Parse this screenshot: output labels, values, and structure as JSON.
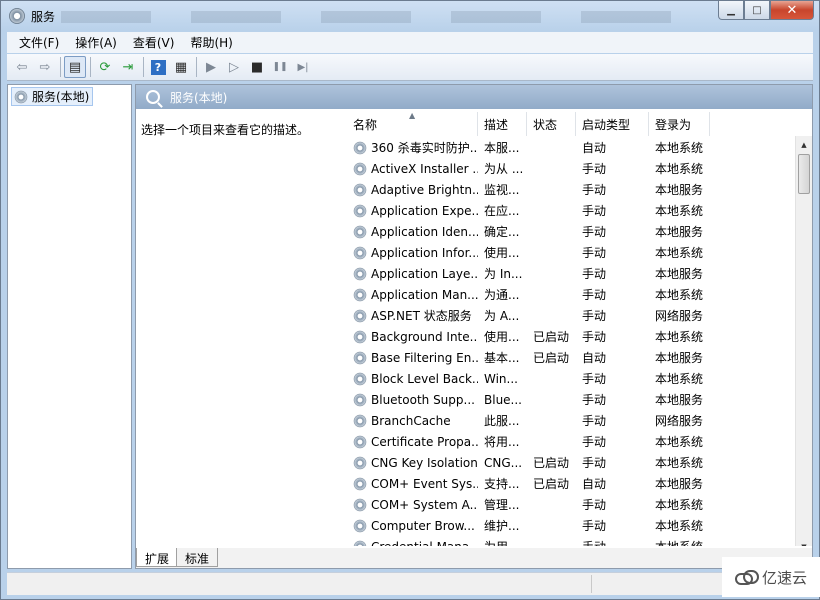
{
  "window": {
    "title": "服务",
    "minimize_glyph": "▁",
    "maximize_glyph": "□",
    "close_glyph": "✕"
  },
  "menu": {
    "items": [
      "文件(F)",
      "操作(A)",
      "查看(V)",
      "帮助(H)"
    ]
  },
  "toolbar": {
    "buttons": [
      {
        "icon": "back-arrow-icon",
        "glyph": "⇦"
      },
      {
        "icon": "forward-arrow-icon",
        "glyph": "⇨"
      },
      {
        "icon": "console-tree-icon",
        "glyph": "▤"
      },
      {
        "icon": "refresh-icon",
        "glyph": "⟳"
      },
      {
        "icon": "export-list-icon",
        "glyph": "⇥"
      },
      {
        "icon": "help-icon",
        "glyph": "?"
      },
      {
        "icon": "properties-icon",
        "glyph": "▦"
      },
      {
        "icon": "start-icon",
        "glyph": "▶"
      },
      {
        "icon": "start-alt-icon",
        "glyph": "▷"
      },
      {
        "icon": "stop-icon",
        "glyph": "■"
      },
      {
        "icon": "pause-icon",
        "glyph": "❚❚"
      },
      {
        "icon": "resume-icon",
        "glyph": "▶|"
      }
    ]
  },
  "tree": {
    "root_label": "服务(本地)"
  },
  "pane": {
    "header": "服务(本地)",
    "description_hint": "选择一个项目来查看它的描述。"
  },
  "list": {
    "columns": [
      "名称",
      "描述",
      "状态",
      "启动类型",
      "登录为"
    ],
    "rows": [
      [
        "360 杀毒实时防护...",
        "本服...",
        "",
        "自动",
        "本地系统"
      ],
      [
        "ActiveX Installer ...",
        "为从 ...",
        "",
        "手动",
        "本地系统"
      ],
      [
        "Adaptive Brightn...",
        "监视...",
        "",
        "手动",
        "本地服务"
      ],
      [
        "Application Expe...",
        "在应...",
        "",
        "手动",
        "本地系统"
      ],
      [
        "Application Iden...",
        "确定...",
        "",
        "手动",
        "本地服务"
      ],
      [
        "Application Infor...",
        "使用...",
        "",
        "手动",
        "本地系统"
      ],
      [
        "Application Laye...",
        "为 In...",
        "",
        "手动",
        "本地服务"
      ],
      [
        "Application Man...",
        "为通...",
        "",
        "手动",
        "本地系统"
      ],
      [
        "ASP.NET 状态服务",
        "为 A...",
        "",
        "手动",
        "网络服务"
      ],
      [
        "Background Inte...",
        "使用...",
        "已启动",
        "手动",
        "本地系统"
      ],
      [
        "Base Filtering En...",
        "基本...",
        "已启动",
        "自动",
        "本地服务"
      ],
      [
        "Block Level Back...",
        "Win...",
        "",
        "手动",
        "本地系统"
      ],
      [
        "Bluetooth Supp...",
        "Blue...",
        "",
        "手动",
        "本地服务"
      ],
      [
        "BranchCache",
        "此服...",
        "",
        "手动",
        "网络服务"
      ],
      [
        "Certificate Propa...",
        "将用...",
        "",
        "手动",
        "本地系统"
      ],
      [
        "CNG Key Isolation",
        "CNG...",
        "已启动",
        "手动",
        "本地系统"
      ],
      [
        "COM+ Event Sys...",
        "支持...",
        "已启动",
        "自动",
        "本地服务"
      ],
      [
        "COM+ System A...",
        "管理...",
        "",
        "手动",
        "本地系统"
      ],
      [
        "Computer Brow...",
        "维护...",
        "",
        "手动",
        "本地系统"
      ],
      [
        "Credential Mana...",
        "为用...",
        "",
        "手动",
        "本地系统"
      ]
    ]
  },
  "tabs": [
    "扩展",
    "标准"
  ],
  "watermark": "亿速云"
}
